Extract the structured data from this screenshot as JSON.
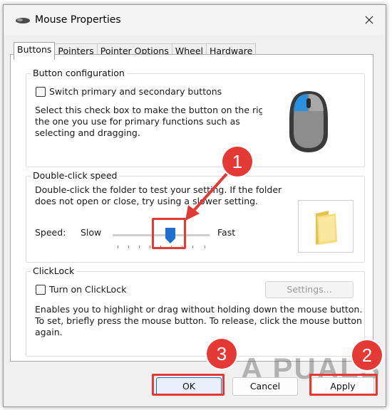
{
  "window": {
    "title": "Mouse Properties"
  },
  "tabs": [
    {
      "label": "Buttons",
      "active": true
    },
    {
      "label": "Pointers"
    },
    {
      "label": "Pointer Options"
    },
    {
      "label": "Wheel"
    },
    {
      "label": "Hardware"
    }
  ],
  "button_config": {
    "title": "Button configuration",
    "checkbox_label": "Switch primary and secondary buttons",
    "checked": false,
    "description_lines": [
      "Select this check box to make the button on the right",
      "the one you use for primary functions such as",
      "selecting and dragging."
    ]
  },
  "double_click": {
    "title": "Double-click speed",
    "description_lines": [
      "Double-click the folder to test your setting. If the folder",
      "does not open or close, try using a slower setting."
    ],
    "speed_label": "Speed:",
    "slow_label": "Slow",
    "fast_label": "Fast",
    "slider_value_fraction": 0.55
  },
  "clicklock": {
    "title": "ClickLock",
    "checkbox_label": "Turn on ClickLock",
    "checked": false,
    "settings_label": "Settings...",
    "description_lines": [
      "Enables you to highlight or drag without holding down the mouse button.",
      "To set, briefly press the mouse button. To release, click the mouse button",
      "again."
    ]
  },
  "buttons": {
    "ok": "OK",
    "cancel": "Cancel",
    "apply": "Apply"
  },
  "annotations": {
    "step1": "1",
    "step2": "2",
    "step3": "3"
  },
  "watermark": "A PUALS",
  "colors": {
    "annotation_red": "#e53935",
    "accent_blue": "#1f6fd0",
    "mouse_blue": "#2b8fe0"
  },
  "icons": [
    "mouse-app-icon",
    "close-icon",
    "mouse-illustration",
    "folder-icon",
    "arrow-annotation"
  ]
}
